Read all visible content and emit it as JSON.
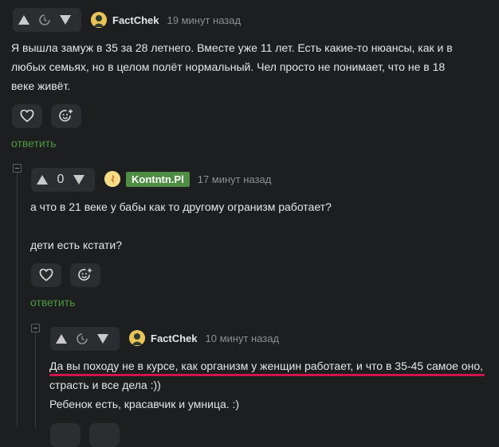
{
  "comments": [
    {
      "user": "FactChek",
      "time": "19 минут назад",
      "score": "",
      "lines": [
        "Я вышла замуж в 35 за 28 летнего. Вместе уже 11 лет. Есть какие-то нюансы, как и в",
        "любых семьях, но в целом полёт нормальный. Чел просто не понимает, что не в 18",
        "веке живёт."
      ],
      "reply_label": "ответить"
    },
    {
      "user": "Kontntn.Pl",
      "time": "17 минут назад",
      "score": "0",
      "lines": [
        "а что в 21 веке у бабы как то другому огранизм работает?",
        "",
        "дети есть кстати?"
      ],
      "reply_label": "ответить"
    },
    {
      "user": "FactChek",
      "time": "10 минут назад",
      "score": "",
      "lines": [
        "Да вы походу не в курсе, как организм у женщин работает, и что в 35-45 самое оно,",
        "страсть и все дела :))",
        "Ребенок есть, красавчик и умница. :)"
      ],
      "highlight_color": "#d0154b"
    }
  ],
  "icons": {
    "upvote": "upvote-arrow-icon",
    "downvote": "downvote-arrow-icon",
    "pending": "clock-icon",
    "like": "heart-icon",
    "react": "emoji-add-icon",
    "collapse": "collapse-minus-icon"
  },
  "colors": {
    "background": "#1d1e20",
    "button": "#2b2d30",
    "reply": "#4e9a3f",
    "badge": "#4e8d43",
    "highlight": "#d0154b"
  }
}
